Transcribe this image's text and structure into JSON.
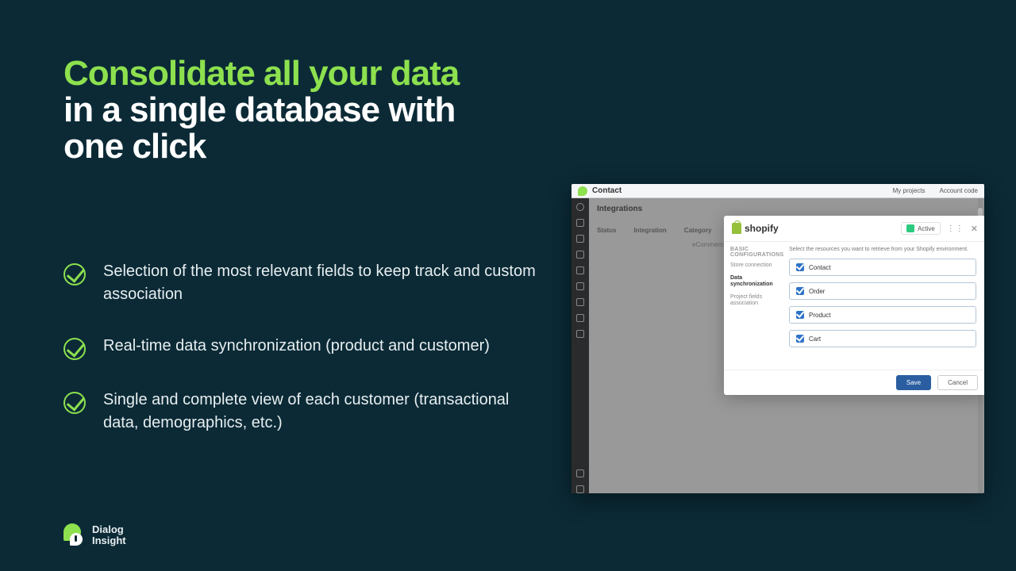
{
  "headline": {
    "accent": "Consolidate all your data",
    "plain1": "in a single database with",
    "plain2": "one click"
  },
  "bullets": [
    "Selection of the most relevant fields to keep track and custom association",
    " Real-time data synchronization (product and customer)",
    "Single and complete view of each customer (transactional data, demographics, etc.)"
  ],
  "brand": {
    "line1": "Dialog",
    "line2": "Insight"
  },
  "panel": {
    "topTitle": "Contact",
    "topLinks": [
      "My projects",
      "Account code"
    ],
    "heading": "Integrations",
    "columns": [
      "Status",
      "Integration",
      "Category"
    ],
    "rowCategory": "eCommerce",
    "modal": {
      "provider": "shopify",
      "activeLabel": "Active",
      "sectionTitle": "BASIC CONFIGURATIONS",
      "steps": [
        {
          "label": "Store connection",
          "current": false
        },
        {
          "label": "Data synchronization",
          "current": true
        },
        {
          "label": "Project fields association",
          "current": false
        }
      ],
      "description": "Select the resources you want to retrieve from your Shopify environment.",
      "resources": [
        "Contact",
        "Order",
        "Product",
        "Cart"
      ],
      "save": "Save",
      "cancel": "Cancel"
    }
  }
}
